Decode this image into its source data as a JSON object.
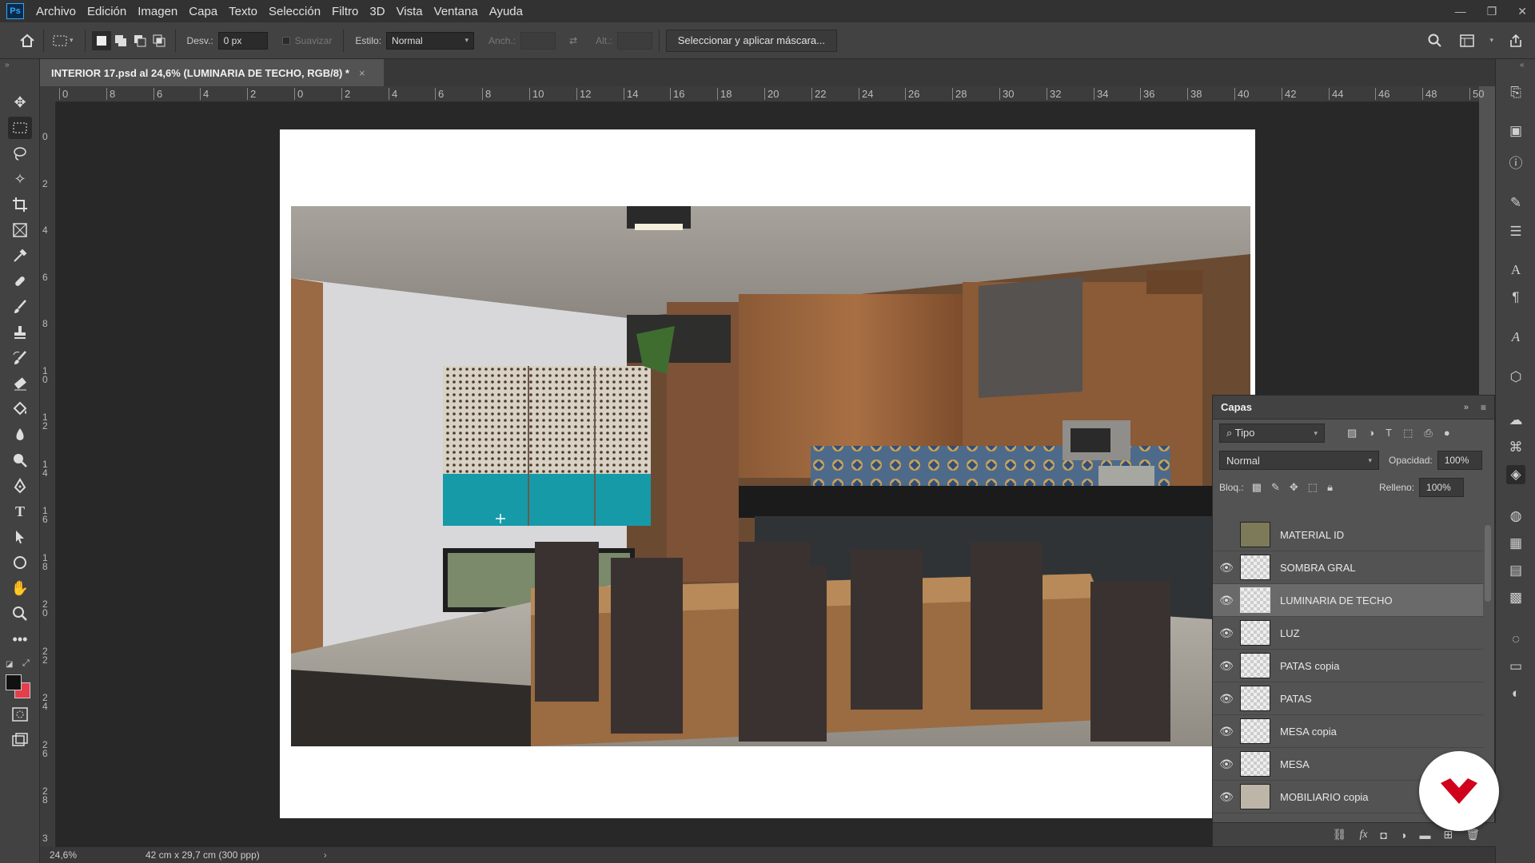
{
  "app": {
    "logo": "Ps"
  },
  "menu": [
    "Archivo",
    "Edición",
    "Imagen",
    "Capa",
    "Texto",
    "Selección",
    "Filtro",
    "3D",
    "Vista",
    "Ventana",
    "Ayuda"
  ],
  "options": {
    "feather_label": "Desv.:",
    "feather_value": "0 px",
    "antialias_label": "Suavizar",
    "style_label": "Estilo:",
    "style_value": "Normal",
    "width_label": "Anch.:",
    "height_label": "Alt.:",
    "select_mask_button": "Seleccionar y aplicar máscara..."
  },
  "document": {
    "tab_title": "INTERIOR 17.psd al 24,6% (LUMINARIA DE TECHO, RGB/8) *",
    "close": "×"
  },
  "ruler": {
    "h_labels": [
      "0",
      "8",
      "6",
      "4",
      "2",
      "0",
      "2",
      "4",
      "6",
      "8",
      "10",
      "12",
      "14",
      "16",
      "18",
      "20",
      "22",
      "24",
      "26",
      "28",
      "30",
      "32",
      "34",
      "36",
      "38",
      "40",
      "42",
      "44",
      "46",
      "48",
      "50"
    ],
    "v_labels": [
      "0",
      "2",
      "4",
      "6",
      "8",
      "1 0",
      "1 2",
      "1 4",
      "1 6",
      "1 8",
      "2 0",
      "2 2",
      "2 4",
      "2 6",
      "2 8",
      "3"
    ]
  },
  "status": {
    "zoom": "24,6%",
    "doc_size": "42 cm x 29,7 cm (300 ppp)",
    "arrow": "›"
  },
  "layers_panel": {
    "title": "Capas",
    "filter_label": "Tipo",
    "blend_mode": "Normal",
    "opacity_label": "Opacidad:",
    "opacity_value": "100%",
    "lock_label": "Bloq.:",
    "fill_label": "Relleno:",
    "fill_value": "100%",
    "layers": [
      {
        "name": "MATERIAL ID",
        "visible": false
      },
      {
        "name": "SOMBRA GRAL",
        "visible": true
      },
      {
        "name": "LUMINARIA DE TECHO",
        "visible": true,
        "selected": true
      },
      {
        "name": "LUZ",
        "visible": true
      },
      {
        "name": "PATAS  copia",
        "visible": true
      },
      {
        "name": "PATAS",
        "visible": true
      },
      {
        "name": "MESA copia",
        "visible": true
      },
      {
        "name": "MESA",
        "visible": true
      },
      {
        "name": "MOBILIARIO copia",
        "visible": true
      }
    ]
  },
  "colors": {
    "brand_badge": "#d0021b",
    "accent": "#31a8ff",
    "panel": "#535353"
  }
}
